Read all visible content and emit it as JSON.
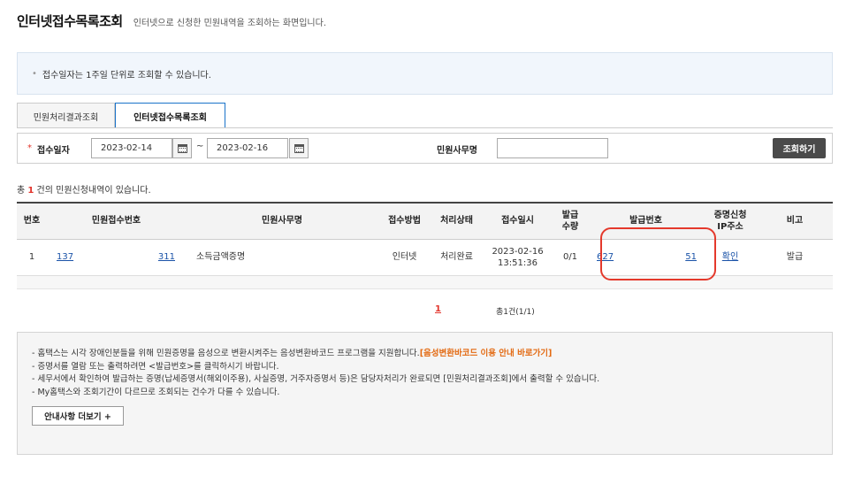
{
  "header": {
    "title": "인터넷접수목록조회",
    "description": "인터넷으로 신청한 민원내역을 조회하는 화면입니다."
  },
  "notice": {
    "bullet": "•",
    "text": "접수일자는 1주일 단위로 조회할 수 있습니다."
  },
  "tabs": [
    {
      "label": "민원처리결과조회",
      "active": false
    },
    {
      "label": "인터넷접수목록조회",
      "active": true
    }
  ],
  "search": {
    "required_mark": "*",
    "date_label": "접수일자",
    "date_from": "2023-02-14",
    "date_to": "2023-02-16",
    "range_sep": "~",
    "name_label": "민원사무명",
    "name_value": "",
    "button_label": "조회하기"
  },
  "result": {
    "prefix": "총",
    "count": "1",
    "suffix": "건의 민원신청내역이 있습니다."
  },
  "table": {
    "headers": {
      "no": "번호",
      "recv_no": "민원접수번호",
      "name": "민원사무명",
      "method": "접수방법",
      "status": "처리상태",
      "recv_date": "접수일시",
      "qty_1": "발급",
      "qty_2": "수량",
      "issue_no": "발급번호",
      "ip_1": "증명신청",
      "ip_2": "IP주소",
      "note": "비고"
    },
    "rows": [
      {
        "no": "1",
        "recv_no_start": "137",
        "recv_no_end": "311",
        "name": "소득금액증명",
        "method": "인터넷",
        "status": "처리완료",
        "recv_date": "2023-02-16",
        "recv_time": "13:51:36",
        "qty": "0/1",
        "issue_no_start": "627",
        "issue_no_end": "51",
        "ip": "확인",
        "note": "발급"
      }
    ]
  },
  "pager": {
    "current": "1",
    "total": "총1건(1/1)"
  },
  "info": {
    "line1": "- 홈택스는 시각 장애인분들을 위해 민원증명을 음성으로 변환시켜주는 음성변환바코드 프로그램을 지원합니다.",
    "line1_link": "[음성변환바코드 이용 안내 바로가기]",
    "line2": "- 증명서를 열람 또는 출력하려면 <발급번호>를 클릭하시기 바랍니다.",
    "line3": "- 세무서에서 확인하여 발급하는 증명(납세증명서(해외이주용), 사실증명, 거주자증명서 등)은 담당자처리가 완료되면 [민원처리결과조회]에서 출력할 수 있습니다.",
    "line4": "- My홈택스와 조회기간이 다르므로 조회되는 건수가 다를 수 있습니다.",
    "more_label": "안내사항 더보기 +"
  },
  "colors": {
    "required": "#e2342b",
    "link": "#1b53a8",
    "highlight": "#e4392c",
    "info_link": "#e36a12",
    "search_button": "#4a4a4a"
  }
}
